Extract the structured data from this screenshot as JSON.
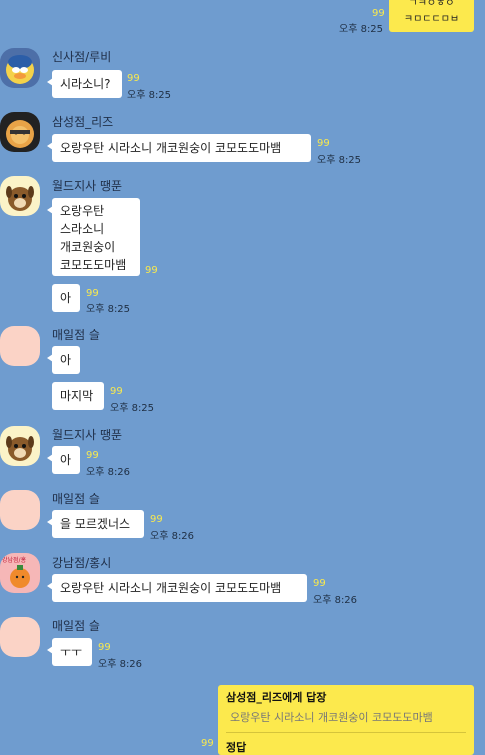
{
  "top": {
    "count": "99",
    "time": "오후 8:25",
    "bubble_line1": "ㄱㅋㅇㅎㅇ",
    "bubble_line2": "ㅋㅁㄷㄷㅁㅂ"
  },
  "messages": [
    {
      "sender": "신사점/루비",
      "text": "시라소니?",
      "count": "99",
      "time": "오후 8:25"
    },
    {
      "sender": "삼성점_리즈",
      "text": "오랑우탄 시라소니 개코원숭이 코모도도마뱀",
      "count": "99",
      "time": "오후 8:25"
    },
    {
      "sender": "월드지사 땡푼",
      "lines": [
        "오랑우탄",
        "스라소니",
        "개코원숭이",
        "코모도도마뱀"
      ],
      "count": "99",
      "text2": "아",
      "count2": "99",
      "time2": "오후 8:25"
    },
    {
      "sender": "매일점 슬",
      "text": "아",
      "text2": "마지막",
      "count2": "99",
      "time2": "오후 8:25"
    },
    {
      "sender": "월드지사 땡푼",
      "text": "아",
      "count": "99",
      "time": "오후 8:26"
    },
    {
      "sender": "매일점 슬",
      "text": "을 모르겠너스",
      "count": "99",
      "time": "오후 8:26"
    },
    {
      "sender": "강남점/홍시",
      "text": "오랑우탄 시라소니 개코원숭이 코모도도마뱀",
      "count": "99",
      "time": "오후 8:26"
    },
    {
      "sender": "매일점 슬",
      "text": "ㅜㅜ",
      "count": "99",
      "time": "오후 8:26"
    }
  ],
  "reply": {
    "title": "삼성점_리즈에게 답장",
    "quote": "오랑우탄 시라소니 개코원숭이 코모도도마뱀",
    "answer": "정답",
    "count": "99"
  },
  "avatar_badge": "강남점/홍"
}
